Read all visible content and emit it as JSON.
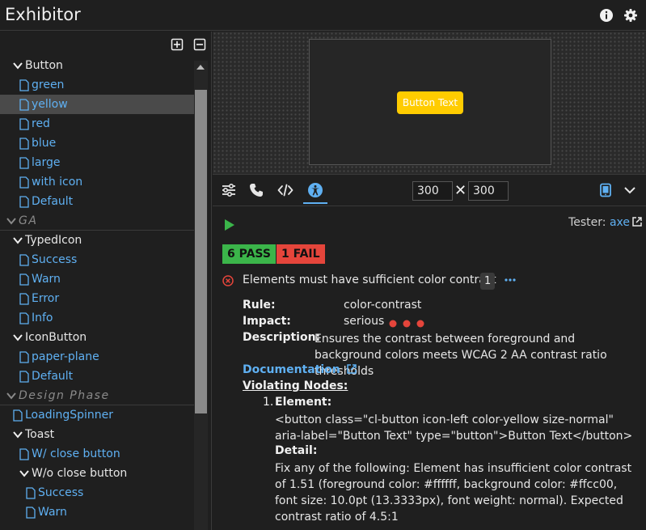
{
  "app": {
    "title": "Exhibitor"
  },
  "sidebar": {
    "groups": [
      {
        "label": "Button",
        "items": [
          "green",
          "yellow",
          "red",
          "blue",
          "large",
          "with icon",
          "Default"
        ]
      },
      {
        "section": "GA"
      },
      {
        "label": "TypedIcon",
        "items": [
          "Success",
          "Warn",
          "Error",
          "Info"
        ]
      },
      {
        "label": "IconButton",
        "items": [
          "paper-plane",
          "Default"
        ]
      },
      {
        "section": "Design Phase"
      },
      {
        "leaf": "LoadingSpinner"
      },
      {
        "label": "Toast",
        "children": [
          {
            "leaf": "W/ close button"
          },
          {
            "label": "W/o close button",
            "items": [
              "Success",
              "Warn"
            ]
          }
        ]
      }
    ],
    "selected": "yellow"
  },
  "preview": {
    "button_label": "Button Text",
    "button_bg": "#ffcc00"
  },
  "toolbar": {
    "width": "300",
    "height": "300",
    "times": "✕",
    "active_tab": "accessibility"
  },
  "a11y": {
    "tester_label": "Tester:",
    "tester_value": "axe",
    "pass_label": "6 PASS",
    "fail_label": "1 FAIL",
    "violation": {
      "title": "Elements must have sufficient color contrast",
      "count": "1",
      "rule_label": "Rule:",
      "rule_value": "color-contrast",
      "impact_label": "Impact:",
      "impact_value": "serious",
      "impact_level": 3,
      "description_label": "Description:",
      "description_value": "Ensures the contrast between foreground and background colors meets WCAG 2 AA contrast ratio thresholds",
      "documentation_label": "Documentation",
      "violating_nodes_label": "Violating Nodes:",
      "nodes": [
        {
          "number": "1.",
          "element_label": "Element:",
          "element_html": "<button class=\"cl-button icon-left color-yellow size-normal\" aria-label=\"Button Text\" type=\"button\">Button Text</button>",
          "detail_label": "Detail:",
          "detail_text": "Fix any of the following: Element has insufficient color contrast of 1.51 (foreground color: #ffffff, background color: #ffcc00, font size: 10.0pt (13.3333px), font weight: normal). Expected contrast ratio of 4.5:1"
        }
      ]
    }
  },
  "colors": {
    "pass": "#3bb54a",
    "fail": "#e5453b",
    "link": "#5fb0f2",
    "accent": "#5fb0f2"
  }
}
